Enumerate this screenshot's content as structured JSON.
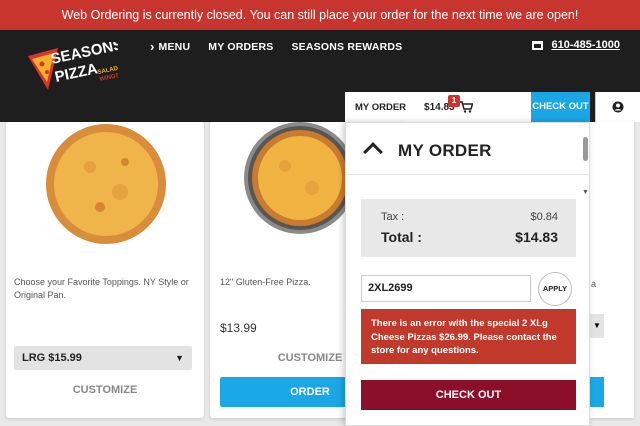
{
  "banner": {
    "text": "Web Ordering is currently closed. You can still place your order for the next time we are open!"
  },
  "brand": {
    "name_line1": "SEASONS",
    "name_line2": "PIZZA",
    "tag1": "SALAD",
    "tag2": "WINGS"
  },
  "nav": {
    "menu": "MENU",
    "my_orders": "MY ORDERS",
    "rewards": "SEASONS REWARDS"
  },
  "phone": "610-485-1000",
  "order_bar": {
    "label": "MY ORDER",
    "amount": "$14.83",
    "badge": "1",
    "checkout": "CHECK OUT"
  },
  "products": [
    {
      "description": "Choose your Favorite Toppings. NY Style or Original Pan.",
      "size_option": "LRG  $15.99",
      "customize": "CUSTOMIZE"
    },
    {
      "description": "12\" Gluten-Free Pizza.",
      "price": "$13.99",
      "customize": "CUSTOMIZE",
      "order": "ORDER"
    }
  ],
  "peek": {
    "text": "a"
  },
  "panel": {
    "title": "MY ORDER",
    "tax_label": "Tax :",
    "tax_value": "$0.84",
    "total_label": "Total :",
    "total_value": "$14.83",
    "promo_code": "2XL2699",
    "apply": "APPLY",
    "error": "There is an error with the special 2 XLg Cheese Pizzas $26.99. Please contact the store for any questions.",
    "checkout": "CHECK OUT"
  },
  "colors": {
    "brand_red": "#c8352f",
    "accent_blue": "#1aa7e6",
    "checkout_maroon": "#8b0e2a",
    "header_dark": "#1e1e1e"
  }
}
